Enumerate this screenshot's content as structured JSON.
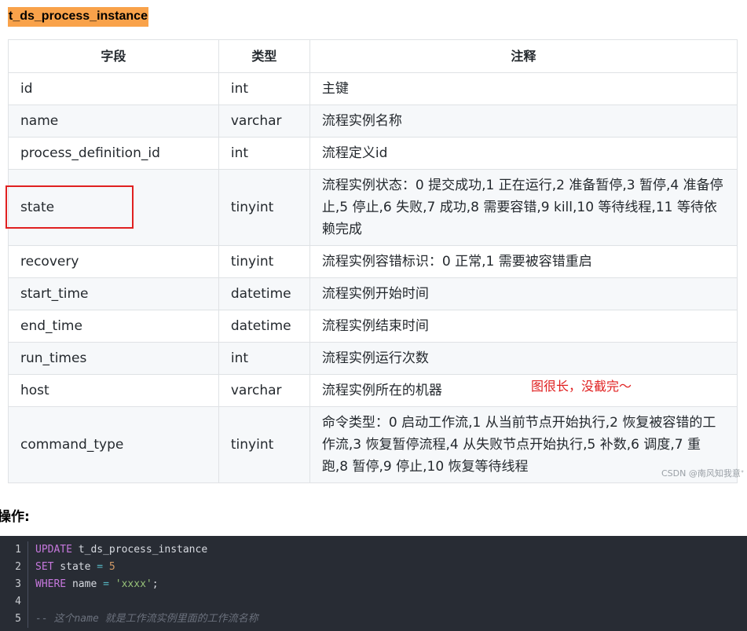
{
  "heading": "t_ds_process_instance",
  "table": {
    "headers": [
      "字段",
      "类型",
      "注释"
    ],
    "rows": [
      {
        "field": "id",
        "type": "int",
        "comment": "主键"
      },
      {
        "field": "name",
        "type": "varchar",
        "comment": "流程实例名称"
      },
      {
        "field": "process_definition_id",
        "type": "int",
        "comment": "流程定义id"
      },
      {
        "field": "state",
        "type": "tinyint",
        "comment": "流程实例状态：0 提交成功,1 正在运行,2 准备暂停,3 暂停,4 准备停止,5 停止,6 失败,7 成功,8 需要容错,9 kill,10 等待线程,11 等待依赖完成"
      },
      {
        "field": "recovery",
        "type": "tinyint",
        "comment": "流程实例容错标识：0 正常,1 需要被容错重启"
      },
      {
        "field": "start_time",
        "type": "datetime",
        "comment": "流程实例开始时间"
      },
      {
        "field": "end_time",
        "type": "datetime",
        "comment": "流程实例结束时间"
      },
      {
        "field": "run_times",
        "type": "int",
        "comment": "流程实例运行次数"
      },
      {
        "field": "host",
        "type": "varchar",
        "comment": "流程实例所在的机器"
      },
      {
        "field": "command_type",
        "type": "tinyint",
        "comment": "命令类型：0 启动工作流,1 从当前节点开始执行,2 恢复被容错的工作流,3 恢复暂停流程,4 从失败节点开始执行,5 补数,6 调度,7 重跑,8 暂停,9 停止,10 恢复等待线程"
      }
    ]
  },
  "annotation": "图很长，没截完～",
  "watermark": "CSDN @南风知我意ᐩ",
  "op_label": "操作:",
  "code": {
    "line_numbers": [
      "1",
      "2",
      "3",
      "4",
      "5"
    ],
    "l1_kw": "UPDATE",
    "l1_id": " t_ds_process_instance",
    "l2_kw": "SET",
    "l2_id": " state ",
    "l2_op": "=",
    "l2_num": " 5",
    "l3_kw": "WHERE",
    "l3_id": " name ",
    "l3_op": "=",
    "l3_str": " 'xxxx'",
    "l3_end": ";",
    "l5_comment": "-- 这个name 就是工作流实例里面的工作流名称"
  },
  "colors": {
    "heading_highlight": "#f9a24a",
    "annotation_red": "#e02020",
    "code_bg": "#282c34"
  }
}
